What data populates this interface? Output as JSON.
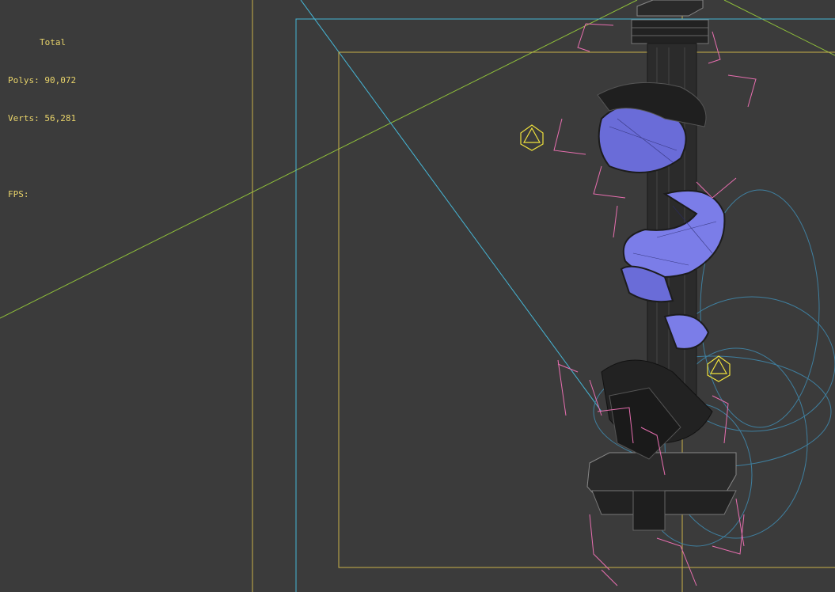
{
  "viewport": {
    "name": "3d-perspective-viewport",
    "colors": {
      "background": "#3b3b3b",
      "stats_text": "#e8d36a",
      "safe_frame": "#c9b24a",
      "cyan_frame": "#46b6d6",
      "horizon_line": "#8fbf3a",
      "light_gizmo": "#f0e23c",
      "bone_gizmo": "#e86fb0",
      "wire": "#1c1c1c",
      "dragon_mesh": "#7b7de8",
      "spline": "#3f7f9f"
    }
  },
  "stats": {
    "title": "Total",
    "polys_label": "Polys:",
    "polys_value": "90,072",
    "verts_label": "Verts:",
    "verts_value": "56,281",
    "fps_label": "FPS:",
    "fps_value": ""
  }
}
